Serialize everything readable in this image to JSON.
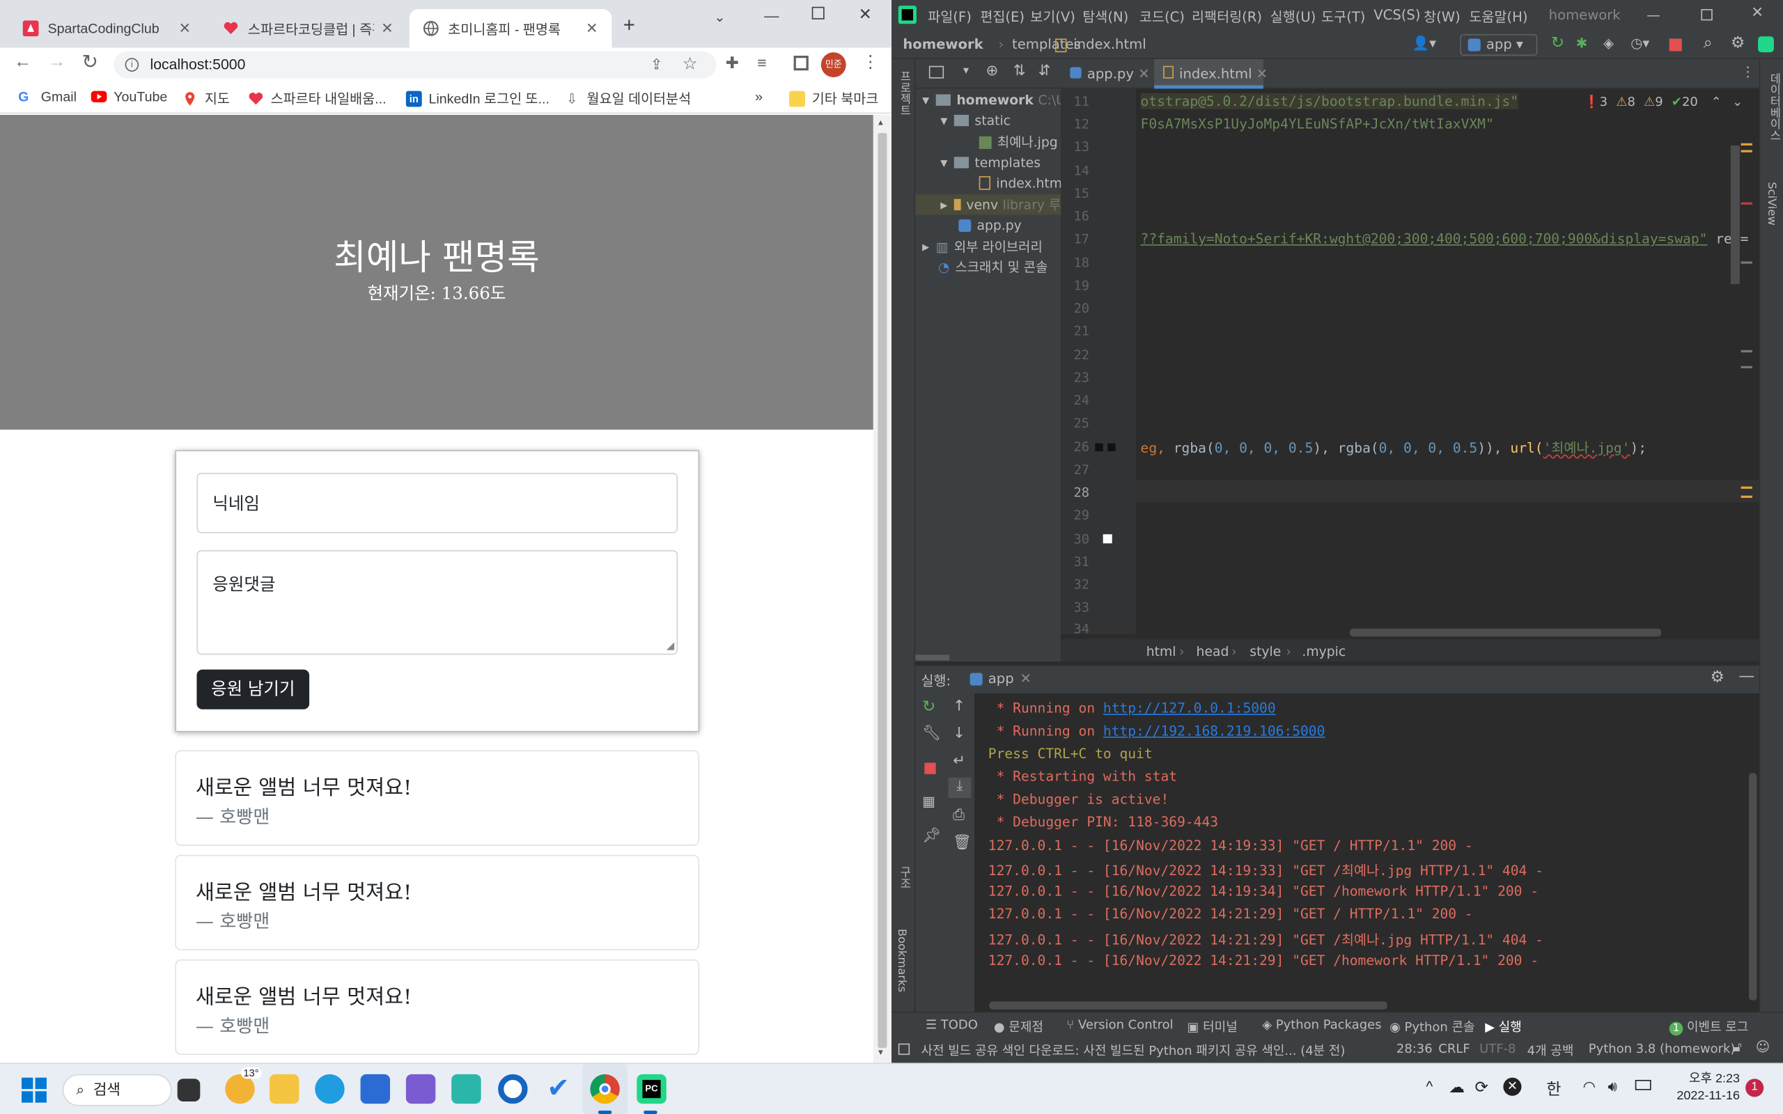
{
  "browser": {
    "tabs": [
      {
        "label": "SpartaCodingClub",
        "favicon": "sparta-logo-icon"
      },
      {
        "label": "스파르타코딩클럽 | 즉흥",
        "favicon": "heart-icon"
      },
      {
        "label": "초미니홈피 - 팬명록",
        "favicon": "globe-icon",
        "active": true
      }
    ],
    "url": "localhost:5000",
    "profile_badge": "민준",
    "bookmarks": [
      "Gmail",
      "YouTube",
      "지도",
      "스파르타 내일배움...",
      "LinkedIn 로그인 또...",
      "월요일 데이터분석"
    ],
    "bookmark_more": "»",
    "other_bookmarks": "기타 북마크"
  },
  "page": {
    "title": "최예나 팬명록",
    "temp_label": "현재기온:",
    "temp_value": "13.66",
    "temp_unit": "도",
    "nickname_placeholder": "닉네임",
    "comment_placeholder": "응원댓글",
    "submit_label": "응원 남기기",
    "comments": [
      {
        "text": "새로운 앨범 너무 멋져요!",
        "author": "— 호빵맨"
      },
      {
        "text": "새로운 앨범 너무 멋져요!",
        "author": "— 호빵맨"
      },
      {
        "text": "새로운 앨범 너무 멋져요!",
        "author": "— 호빵맨"
      }
    ]
  },
  "ide": {
    "menu": [
      "파일(F)",
      "편집(E)",
      "보기(V)",
      "탐색(N)",
      "코드(C)",
      "리팩터링(R)",
      "실행(U)",
      "도구(T)",
      "VCS(S)",
      "창(W)",
      "도움말(H)"
    ],
    "project_name": "homework",
    "breadcrumb": [
      "homework",
      "templates",
      "index.html"
    ],
    "run_config": "app",
    "editor_tabs": [
      "app.py",
      "index.html"
    ],
    "side_label_project": "프로젝트",
    "side_label_structure": "구조",
    "side_label_bookmarks": "Bookmarks",
    "right_label_db": "데이터베이스",
    "right_label_sciview": "SciView",
    "tree": [
      {
        "label": "homework",
        "suffix": "C:\\U"
      },
      {
        "label": "static"
      },
      {
        "label": "최예나.jpg"
      },
      {
        "label": "templates"
      },
      {
        "label": "index.html"
      },
      {
        "label": "venv",
        "suffix": "library 루"
      },
      {
        "label": "app.py"
      },
      {
        "label": "외부 라이브러리"
      },
      {
        "label": "스크래치 및 콘솔"
      }
    ],
    "inspections": {
      "errors": "3",
      "warnings": "8",
      "weak": "9",
      "ok": "20"
    },
    "line_numbers": [
      "11",
      "12",
      "13",
      "14",
      "15",
      "16",
      "17",
      "18",
      "19",
      "20",
      "21",
      "22",
      "23",
      "24",
      "25",
      "26",
      "27",
      "28",
      "29",
      "30",
      "31",
      "32",
      "33",
      "34"
    ],
    "code": {
      "l11": "otstrap@5.0.2/dist/js/bootstrap.bundle.min.js\"",
      "l12": "F0sA7MsXsP1UyJoMp4YLEuNSfAP+JcXn/tWtIaxVXM\"",
      "l17a": "??family=Noto+Serif+KR:wght@200;300;400;500;600;700;900&display=swap\"",
      "l17b": " rel=",
      "l26a": "eg, ",
      "l26b": "rgba(",
      "l26c": "0, 0, 0, 0.5",
      "l26d": "), ",
      "l26e": "rgba(",
      "l26f": "0, 0, 0, 0.5",
      "l26g": ")), ",
      "l26h": "url(",
      "l26i": "'최예나.jpg'",
      "l26j": ");"
    },
    "editor_breadcrumb": [
      "html",
      "head",
      "style",
      ".mypic"
    ],
    "run_label": "실행:",
    "run_tab": "app",
    "console": [
      {
        "text": " * Running on ",
        "link": "http://127.0.0.1:5000",
        "color": "#e06c5e"
      },
      {
        "text": " * Running on ",
        "link": "http://192.168.219.106:5000",
        "color": "#e06c5e"
      },
      {
        "text": "Press CTRL+C to quit",
        "color": "#b3a24a"
      },
      {
        "text": " * Restarting with stat",
        "color": "#e06c5e"
      },
      {
        "text": " * Debugger is active!",
        "color": "#e06c5e"
      },
      {
        "text": " * Debugger PIN: 118-369-443",
        "color": "#e06c5e"
      },
      {
        "text": "127.0.0.1 - - [16/Nov/2022 14:19:33] \"GET / HTTP/1.1\" 200 -",
        "color": "#e06c5e"
      },
      {
        "text": "127.0.0.1 - - [16/Nov/2022 14:19:33] \"GET /최예나.jpg HTTP/1.1\" 404 -",
        "color": "#e06c5e"
      },
      {
        "text": "127.0.0.1 - - [16/Nov/2022 14:19:34] \"GET /homework HTTP/1.1\" 200 -",
        "color": "#e06c5e"
      },
      {
        "text": "127.0.0.1 - - [16/Nov/2022 14:21:29] \"GET / HTTP/1.1\" 200 -",
        "color": "#e06c5e"
      },
      {
        "text": "127.0.0.1 - - [16/Nov/2022 14:21:29] \"GET /최예나.jpg HTTP/1.1\" 404 -",
        "color": "#e06c5e"
      },
      {
        "text": "127.0.0.1 - - [16/Nov/2022 14:21:29] \"GET /homework HTTP/1.1\" 200 -",
        "color": "#e06c5e"
      }
    ],
    "bottom_tabs": [
      "TODO",
      "문제점",
      "Version Control",
      "터미널",
      "Python Packages",
      "Python 콘솔",
      "실행"
    ],
    "event_log": "이벤트 로그",
    "event_count": "1",
    "status_message": "사전 빌드 공유 색인 다운로드: 사전 빌드된 Python 패키지 공유 색인... (4분 전)",
    "status_position": "28:36",
    "status_eol": "CRLF",
    "status_encoding": "UTF-8",
    "status_indent": "4개 공백",
    "status_interpreter": "Python 3.8 (homework)"
  },
  "taskbar": {
    "search_label": "검색",
    "weather_temp": "13°",
    "ime": "한",
    "time": "오후 2:23",
    "date": "2022-11-16",
    "notification_count": "1"
  },
  "colors": {
    "hero_bg": "#808080",
    "ide_bg": "#2b2b2b",
    "console_text": "#e06c5e",
    "link": "#287bde",
    "submit_bg": "#212529"
  }
}
